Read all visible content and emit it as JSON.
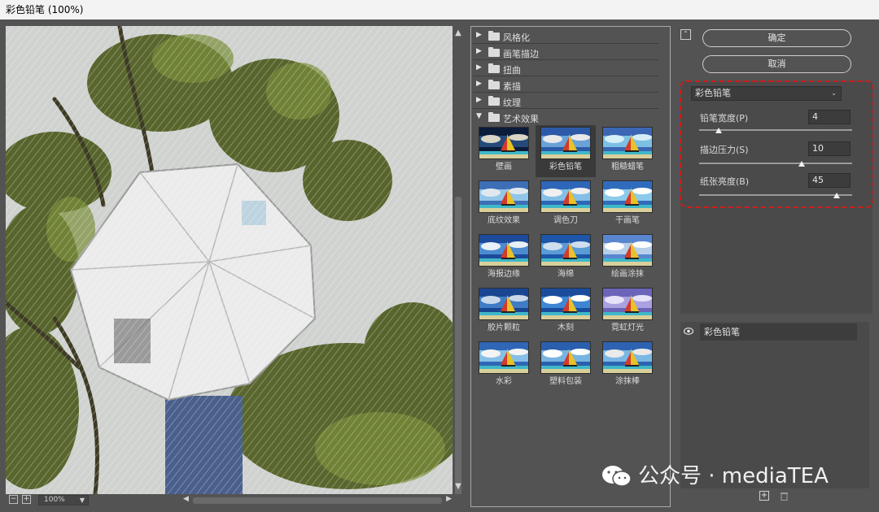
{
  "window": {
    "title": "彩色铅笔 (100%)"
  },
  "preview": {
    "zoom": "100%"
  },
  "gallery": {
    "categories": [
      {
        "label": "风格化",
        "expanded": false
      },
      {
        "label": "画笔描边",
        "expanded": false
      },
      {
        "label": "扭曲",
        "expanded": false
      },
      {
        "label": "素描",
        "expanded": false
      },
      {
        "label": "纹理",
        "expanded": false
      },
      {
        "label": "艺术效果",
        "expanded": true
      }
    ],
    "filters": [
      {
        "label": "壁画"
      },
      {
        "label": "彩色铅笔",
        "selected": true
      },
      {
        "label": "粗糙蜡笔"
      },
      {
        "label": "底纹效果"
      },
      {
        "label": "调色刀"
      },
      {
        "label": "干画笔"
      },
      {
        "label": "海报边缘"
      },
      {
        "label": "海绵"
      },
      {
        "label": "绘画涂抹"
      },
      {
        "label": "胶片颗粒"
      },
      {
        "label": "木刻"
      },
      {
        "label": "霓虹灯光"
      },
      {
        "label": "水彩"
      },
      {
        "label": "塑料包装"
      },
      {
        "label": "涂抹棒"
      }
    ]
  },
  "buttons": {
    "ok": "确定",
    "cancel": "取消"
  },
  "settings": {
    "filter": "彩色铅笔",
    "params": [
      {
        "label": "铅笔宽度(P)",
        "value": "4",
        "fraction": 0.13
      },
      {
        "label": "描边压力(S)",
        "value": "10",
        "fraction": 0.67
      },
      {
        "label": "纸张亮度(B)",
        "value": "45",
        "fraction": 0.9
      }
    ]
  },
  "layers": {
    "items": [
      {
        "label": "彩色铅笔"
      }
    ]
  },
  "watermark": {
    "text": "公众号 · mediaTEA"
  }
}
